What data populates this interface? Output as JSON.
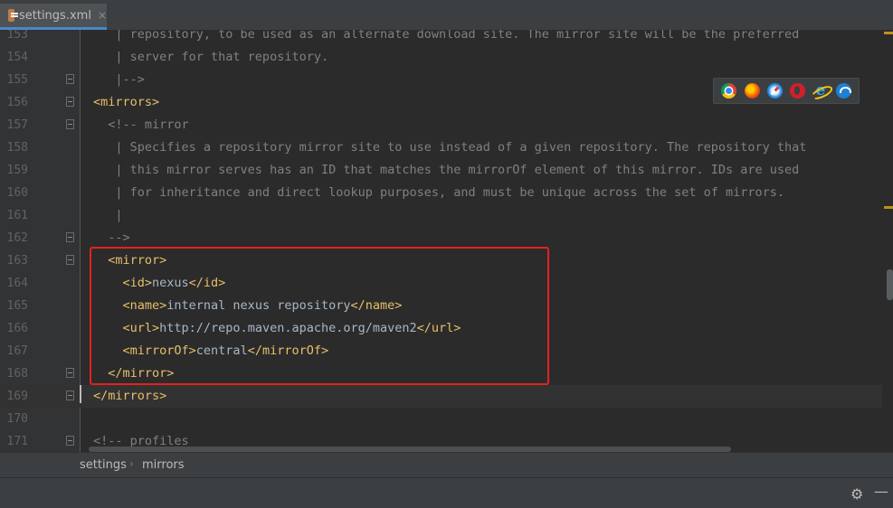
{
  "tab": {
    "title": "settings.xml",
    "close": "×"
  },
  "lines": [
    {
      "num": "153",
      "parts": [
        {
          "cls": "c-comment",
          "text": "   | repository, to be used as an alternate download site. The mirror site will be the preferred"
        }
      ]
    },
    {
      "num": "154",
      "parts": [
        {
          "cls": "c-comment",
          "text": "   | server for that repository."
        }
      ]
    },
    {
      "num": "155",
      "parts": [
        {
          "cls": "c-comment",
          "text": "   |-->"
        }
      ]
    },
    {
      "num": "156",
      "parts": [
        {
          "cls": "c-tag",
          "text": "<mirrors>"
        }
      ]
    },
    {
      "num": "157",
      "parts": [
        {
          "cls": "c-comment",
          "text": "  <!-- mirror"
        }
      ]
    },
    {
      "num": "158",
      "parts": [
        {
          "cls": "c-comment",
          "text": "   | Specifies a repository mirror site to use instead of a given repository. The repository that"
        }
      ]
    },
    {
      "num": "159",
      "parts": [
        {
          "cls": "c-comment",
          "text": "   | this mirror serves has an ID that matches the mirrorOf element of this mirror. IDs are used"
        }
      ]
    },
    {
      "num": "160",
      "parts": [
        {
          "cls": "c-comment",
          "text": "   | for inheritance and direct lookup purposes, and must be unique across the set of mirrors."
        }
      ]
    },
    {
      "num": "161",
      "parts": [
        {
          "cls": "c-comment",
          "text": "   |"
        }
      ]
    },
    {
      "num": "162",
      "parts": [
        {
          "cls": "c-comment",
          "text": "  -->"
        }
      ]
    },
    {
      "num": "163",
      "parts": [
        {
          "cls": "c-tag",
          "text": "  <mirror>"
        }
      ]
    },
    {
      "num": "164",
      "parts": [
        {
          "cls": "c-tag",
          "text": "    <id>"
        },
        {
          "cls": "c-text",
          "text": "nexus"
        },
        {
          "cls": "c-tag",
          "text": "</id>"
        }
      ]
    },
    {
      "num": "165",
      "parts": [
        {
          "cls": "c-tag",
          "text": "    <name>"
        },
        {
          "cls": "c-text",
          "text": "internal nexus repository"
        },
        {
          "cls": "c-tag",
          "text": "</name>"
        }
      ]
    },
    {
      "num": "166",
      "parts": [
        {
          "cls": "c-tag",
          "text": "    <url>"
        },
        {
          "cls": "c-text",
          "text": "http://repo.maven.apache.org/maven2"
        },
        {
          "cls": "c-tag",
          "text": "</url>"
        }
      ]
    },
    {
      "num": "167",
      "parts": [
        {
          "cls": "c-tag",
          "text": "    <mirrorOf>"
        },
        {
          "cls": "c-text",
          "text": "central"
        },
        {
          "cls": "c-tag",
          "text": "</mirrorOf>"
        }
      ]
    },
    {
      "num": "168",
      "parts": [
        {
          "cls": "c-tag",
          "text": "  </mirror>"
        }
      ]
    },
    {
      "num": "169",
      "parts": [
        {
          "cls": "c-tag",
          "text": "</mirrors>"
        }
      ]
    },
    {
      "num": "170",
      "parts": []
    },
    {
      "num": "171",
      "parts": [
        {
          "cls": "c-comment",
          "text": "<!-- profiles"
        }
      ]
    }
  ],
  "current_line": "169",
  "breadcrumb": {
    "items": [
      "settings",
      "mirrors"
    ],
    "separator": "›"
  },
  "browsers": [
    "chrome-icon",
    "firefox-icon",
    "safari-icon",
    "opera-icon",
    "ie-icon",
    "edge-icon"
  ],
  "ie_glyph": "e",
  "status": {
    "gear": "⚙",
    "minimize": "—"
  },
  "colors": {
    "tag": "#e8bf6a",
    "comment": "#808080",
    "text": "#a9b7c6",
    "highlight": "#e3221e"
  }
}
